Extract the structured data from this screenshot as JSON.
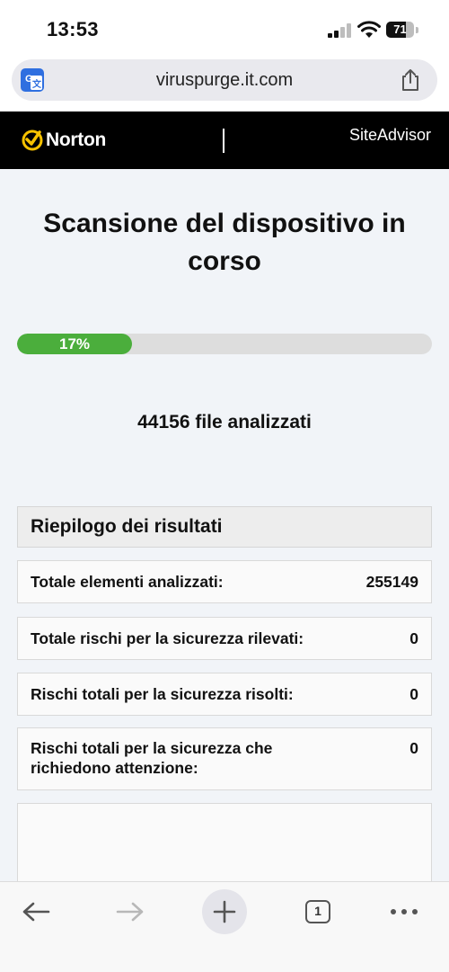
{
  "status_bar": {
    "time": "13:53",
    "battery_level": "71",
    "icons": [
      "signal-icon",
      "wifi-icon",
      "battery-icon"
    ]
  },
  "browser": {
    "url": "viruspurge.it.com",
    "icons": [
      "translate-icon",
      "share-icon"
    ]
  },
  "header": {
    "brand": "Norton",
    "product": "SiteAdvisor"
  },
  "main": {
    "title": "Scansione del dispositivo in corso",
    "progress": {
      "value": 0.17,
      "label": "17%"
    },
    "files_scanned": "44156 file analizzati"
  },
  "summary": {
    "title": "Riepilogo dei risultati",
    "rows": [
      {
        "label": "Totale elementi analizzati:",
        "value": "255149"
      },
      {
        "label": "Totale rischi per la sicurezza rilevati:",
        "value": "0"
      },
      {
        "label": "Rischi totali per la sicurezza risolti:",
        "value": "0"
      },
      {
        "label": "Rischi totali per la sicurezza che richiedono attenzione:",
        "value": "0"
      }
    ]
  },
  "toolbar": {
    "tab_count": "1",
    "icons": [
      "back-arrow-icon",
      "forward-arrow-icon",
      "plus-icon",
      "tabs-icon",
      "more-icon"
    ]
  },
  "colors": {
    "progress": "#4bae3c",
    "header_bg": "#000000",
    "norton_yellow": "#f7c200",
    "page_bg": "#f1f4f8"
  }
}
